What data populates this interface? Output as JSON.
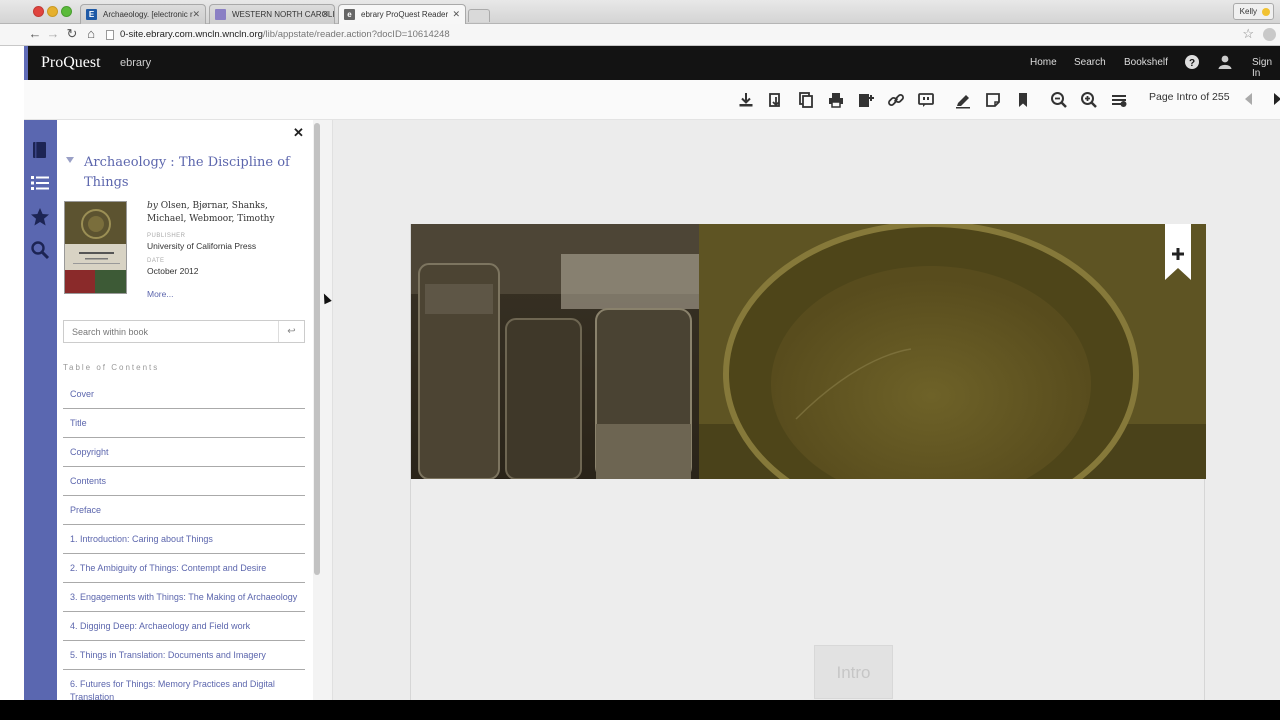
{
  "browser": {
    "tabs": [
      {
        "title": "Archaeology. [electronic r",
        "active": false,
        "favicon": "E",
        "favicon_color": "#1f5aa6"
      },
      {
        "title": "WESTERN NORTH CAROLIN",
        "active": false,
        "favicon": "",
        "favicon_color": "#8a7fc4"
      },
      {
        "title": "ebrary ProQuest Reader",
        "active": true,
        "favicon": "e",
        "favicon_color": "#666666"
      }
    ],
    "user_name": "Kelly",
    "url_host": "0-site.ebrary.com.wncln.wncln.org",
    "url_path": "/lib/appstate/reader.action?docID=10614248"
  },
  "app": {
    "logo": "ProQuest",
    "logo_sub": "ebrary",
    "nav": {
      "home": "Home",
      "search": "Search",
      "bookshelf": "Bookshelf",
      "sign_in": "Sign In"
    },
    "accent_color": "#5a67b0"
  },
  "toolbar": {
    "icons": [
      "download-icon",
      "full-download-icon",
      "copy-icon",
      "print-icon",
      "add-to-bookshelf-icon",
      "link-icon",
      "cite-icon",
      "highlight-icon",
      "note-icon",
      "bookmark-icon",
      "zoom-out-icon",
      "zoom-in-icon",
      "view-settings-icon"
    ],
    "page_indicator": "Page Intro of 255"
  },
  "panel": {
    "book_title": "Archaeology : The Discipline of Things",
    "authors_prefix": "by",
    "authors": "Olsen, Bjørnar, Shanks, Michael, Webmoor, Timothy",
    "publisher_label": "PUBLISHER",
    "publisher": "University of California Press",
    "date_label": "DATE",
    "date": "October 2012",
    "more": "More...",
    "search_placeholder": "Search within book",
    "toc_heading": "Table of Contents",
    "toc": [
      "Cover",
      "Title",
      "Copyright",
      "Contents",
      "Preface",
      "1. Introduction: Caring about Things",
      "2. The Ambiguity of Things: Contempt and Desire",
      "3. Engagements with Things: The Making of Archaeology",
      "4. Digging Deep: Archaeology and Field work",
      "5. Things in Translation: Documents and Imagery",
      "6. Futures for Things: Memory Practices and Digital Translation"
    ]
  },
  "document": {
    "page_label": "Intro"
  }
}
